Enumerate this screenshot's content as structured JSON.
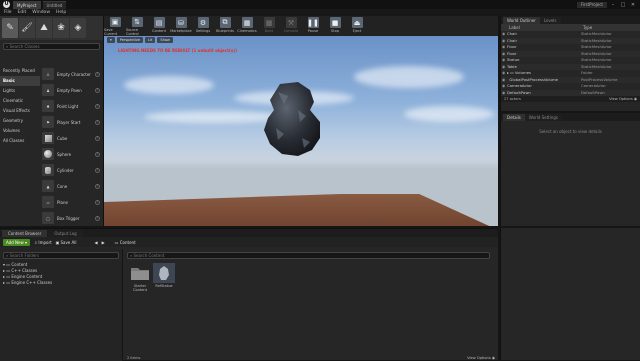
{
  "window": {
    "tabs": [
      "MyProject",
      "Untitled"
    ],
    "project_name": "FirstProject",
    "controls": [
      "–",
      "□",
      "✕"
    ]
  },
  "menu": [
    "File",
    "Edit",
    "Window",
    "Help"
  ],
  "modes": {
    "search_placeholder": "Search Classes",
    "categories": [
      "Recently Placed",
      "Basic",
      "Lights",
      "Cinematic",
      "Visual Effects",
      "Geometry",
      "Volumes",
      "All Classes"
    ],
    "active_category": "Basic",
    "items": [
      "Empty Character",
      "Empty Pawn",
      "Point Light",
      "Player Start",
      "Cube",
      "Sphere",
      "Cylinder",
      "Cone",
      "Plane",
      "Box Trigger",
      "Sphere Trigger"
    ]
  },
  "toolbar": {
    "buttons": [
      "Save Current",
      "Source Control",
      "Content",
      "Marketplace",
      "Settings",
      "Blueprints",
      "Cinematics",
      "Build",
      "Compile",
      "Pause",
      "Stop",
      "Eject"
    ]
  },
  "viewport": {
    "warning": "LIGHTING NEEDS TO BE REBUILT (1 unbuilt object(s))",
    "controls": [
      "Perspective",
      "Lit",
      "Show"
    ]
  },
  "outliner": {
    "tabs": [
      "World Outliner",
      "Levels"
    ],
    "columns": [
      "Label",
      "Type"
    ],
    "rows": [
      {
        "label": "Chair",
        "type": "StaticMeshActor"
      },
      {
        "label": "Chair",
        "type": "StaticMeshActor"
      },
      {
        "label": "Floor",
        "type": "StaticMeshActor"
      },
      {
        "label": "Floor",
        "type": "StaticMeshActor"
      },
      {
        "label": "Statue",
        "type": "StaticMeshActor"
      },
      {
        "label": "Table",
        "type": "StaticMeshActor"
      },
      {
        "label": "Volumes",
        "type": "Folder"
      },
      {
        "label": "GlobalPostProcessVolume",
        "type": "PostProcessVolume"
      },
      {
        "label": "CameraActor",
        "type": "CameraActor"
      },
      {
        "label": "DefaultPawn",
        "type": "DefaultPawn"
      }
    ],
    "count": "27 actors",
    "view_options": "View Options"
  },
  "details": {
    "tabs": [
      "Details",
      "World Settings"
    ],
    "message": "Select an object to view details"
  },
  "content_browser": {
    "tabs": [
      "Content Browser",
      "Output Log"
    ],
    "add_new": "Add New",
    "import": "Import",
    "save_all": "Save All",
    "breadcrumb": "Content",
    "tree_search_placeholder": "Search Folders",
    "asset_search_placeholder": "Search Content",
    "tree": [
      "Content",
      "C++ Classes",
      "Engine Content",
      "Engine C++ Classes"
    ],
    "assets": [
      {
        "name": "Starter Content",
        "kind": "folder"
      },
      {
        "name": "RefStatue",
        "kind": "mesh"
      }
    ],
    "item_count": "2 items",
    "view_options": "View Options"
  }
}
